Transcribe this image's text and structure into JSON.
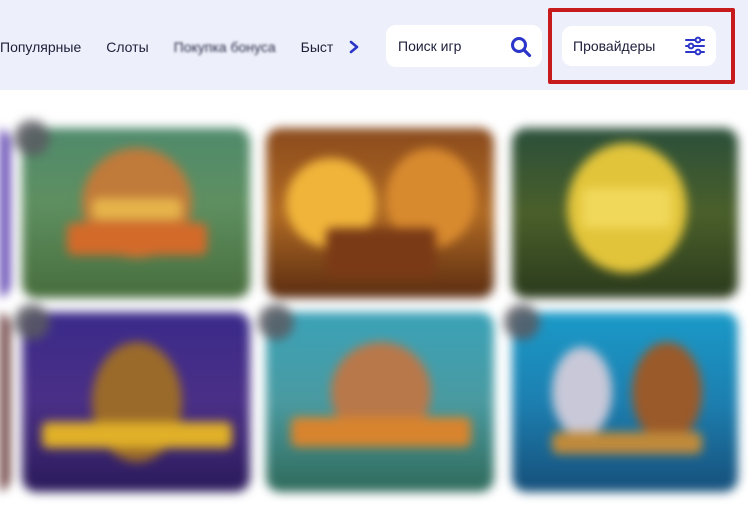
{
  "categories": {
    "items": [
      {
        "label": "Популярные"
      },
      {
        "label": "Слоты"
      },
      {
        "label": "Покупка бонуса"
      },
      {
        "label": "Быст"
      }
    ],
    "next_icon": "chevron-right-icon"
  },
  "search": {
    "placeholder": "Поиск игр",
    "icon": "search-icon"
  },
  "providers": {
    "label": "Провайдеры",
    "icon": "sliders-icon",
    "highlight_color": "#c71a1a"
  },
  "colors": {
    "accent": "#2b35c9",
    "topbar": "#edf0fa"
  }
}
